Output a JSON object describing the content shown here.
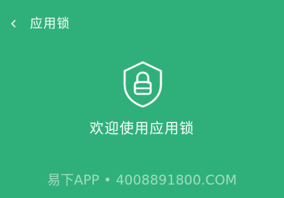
{
  "header": {
    "title": "应用锁",
    "back_icon": "chevron-left-icon"
  },
  "main": {
    "icon": "shield-lock-icon",
    "welcome_text": "欢迎使用应用锁"
  },
  "watermark": {
    "text": "易下APP • 4008891800.COM"
  },
  "colors": {
    "background": "#2fb07a",
    "foreground": "#ffffff"
  }
}
